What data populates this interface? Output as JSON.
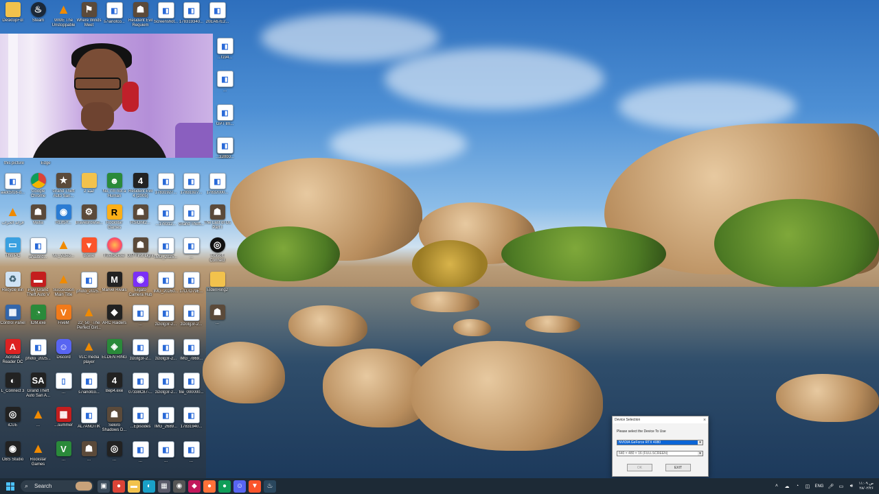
{
  "desktop": {
    "icons": [
      {
        "label": "DesktopFol",
        "glyph": "",
        "kind": "g-folder"
      },
      {
        "label": "Steam",
        "glyph": "♨",
        "kind": "g-steam"
      },
      {
        "label": "WWE The Unstoppable",
        "glyph": "▲",
        "kind": "g-vlc"
      },
      {
        "label": "Where Winds Meet",
        "glyph": "⚑",
        "kind": "g-game"
      },
      {
        "label": "s7ianotco...",
        "glyph": "◧",
        "kind": "g-file"
      },
      {
        "label": "Resident Evil Requiem",
        "glyph": "☗",
        "kind": "g-game"
      },
      {
        "label": "Screenshot...",
        "glyph": "◧",
        "kind": "g-file"
      },
      {
        "label": "178319340...",
        "glyph": "◧",
        "kind": "g-file"
      },
      {
        "label": "20EA67E2...",
        "glyph": "◧",
        "kind": "g-file"
      },
      {
        "label": "this picture",
        "glyph": "",
        "kind": "none"
      },
      {
        "label": "Edge",
        "glyph": "",
        "kind": "none"
      },
      {
        "label": "aadc5f16-d...",
        "glyph": "◧",
        "kind": "g-file"
      },
      {
        "label": "Google Chrome",
        "glyph": "",
        "kind": "g-chrome"
      },
      {
        "label": "Grand Theft Auto San...",
        "glyph": "★",
        "kind": "g-game"
      },
      {
        "label": "لعبة 2",
        "glyph": "",
        "kind": "g-folder"
      },
      {
        "label": "No, I'm not a Human",
        "glyph": "☻",
        "kind": "g-green"
      },
      {
        "label": "Resident Evil 4 (2005)",
        "glyph": "4",
        "kind": "g-dark"
      },
      {
        "label": "17831927...",
        "glyph": "◧",
        "kind": "g-file"
      },
      {
        "label": "17831927...",
        "glyph": "◧",
        "kind": "g-file"
      },
      {
        "label": "17832000...",
        "glyph": "◧",
        "kind": "g-file"
      },
      {
        "label": "قراند الحراب",
        "glyph": "▲",
        "kind": "g-vlc"
      },
      {
        "label": "Mafia",
        "glyph": "☗",
        "kind": "g-game"
      },
      {
        "label": "RLrf5Y...",
        "glyph": "◉",
        "kind": "g-blue"
      },
      {
        "label": "BraveBrowse...",
        "glyph": "⚙",
        "kind": "g-game"
      },
      {
        "label": "Rockstar Games",
        "glyph": "R",
        "kind": "g-rockstar"
      },
      {
        "label": "RSiOnit2...",
        "glyph": "☗",
        "kind": "g-game"
      },
      {
        "label": "...178312...",
        "glyph": "◧",
        "kind": "g-file"
      },
      {
        "label": "Grand Theft...",
        "glyph": "◧",
        "kind": "g-file"
      },
      {
        "label": "The Last of Us Part I",
        "glyph": "☗",
        "kind": "g-game"
      },
      {
        "label": "This PC",
        "glyph": "▭",
        "kind": "g-pc"
      },
      {
        "label": "aNalbrd...",
        "glyph": "◧",
        "kind": "g-file"
      },
      {
        "label": "Mr_Video...",
        "glyph": "▲",
        "kind": "g-vlc"
      },
      {
        "label": "Brave",
        "glyph": "▼",
        "kind": "g-brave"
      },
      {
        "label": "Firefox.exe",
        "glyph": "",
        "kind": "g-firefox"
      },
      {
        "label": "007 First Light",
        "glyph": "☗",
        "kind": "g-game"
      },
      {
        "label": "IMG_2025...",
        "glyph": "◧",
        "kind": "g-file"
      },
      {
        "label": "...",
        "glyph": "◧",
        "kind": "g-file"
      },
      {
        "label": "Ubisoft Connect",
        "glyph": "◎",
        "kind": "g-ubisoft"
      },
      {
        "label": "Recycle Bin",
        "glyph": "♻",
        "kind": "g-recycle"
      },
      {
        "label": "Play Grand Theft Auto V",
        "glyph": "▬",
        "kind": "g-red"
      },
      {
        "label": "Succession Main Title",
        "glyph": "▲",
        "kind": "g-vlc"
      },
      {
        "label": "photo_2025...",
        "glyph": "◧",
        "kind": "g-file"
      },
      {
        "label": "Marvel Rivals",
        "glyph": "M",
        "kind": "g-dark"
      },
      {
        "label": "Elgato Camera Hub",
        "glyph": "◉",
        "kind": "g-elgato"
      },
      {
        "label": "IMG_20260...",
        "glyph": "◧",
        "kind": "g-file"
      },
      {
        "label": "17D7D79E...",
        "glyph": "◧",
        "kind": "g-file"
      },
      {
        "label": "EldenRing2",
        "glyph": "",
        "kind": "g-folder"
      },
      {
        "label": "Control Panel",
        "glyph": "▦",
        "kind": "g-control"
      },
      {
        "label": "IDM.exe",
        "glyph": "◔",
        "kind": "g-green"
      },
      {
        "label": "FiveM",
        "glyph": "V",
        "kind": "g-orange"
      },
      {
        "label": "22_50_ The Perfect Girl...",
        "glyph": "▲",
        "kind": "g-vlc"
      },
      {
        "label": "ARC Raiders",
        "glyph": "◆",
        "kind": "g-dark"
      },
      {
        "label": "...",
        "glyph": "◧",
        "kind": "g-file"
      },
      {
        "label": "zizotg3r-2...",
        "glyph": "◧",
        "kind": "g-file"
      },
      {
        "label": "zizotg3r-2...",
        "glyph": "◧",
        "kind": "g-file"
      },
      {
        "label": "...",
        "glyph": "☗",
        "kind": "g-game"
      },
      {
        "label": "Acrobat Reader DC",
        "glyph": "A",
        "kind": "g-pdf"
      },
      {
        "label": "photo_2025...",
        "glyph": "◧",
        "kind": "g-file"
      },
      {
        "label": "Discord",
        "glyph": "☺",
        "kind": "g-discord"
      },
      {
        "label": "VLC media player",
        "glyph": "▲",
        "kind": "g-vlc"
      },
      {
        "label": "ELDEN RING",
        "glyph": "◈",
        "kind": "g-green"
      },
      {
        "label": "zizotg3r-2...",
        "glyph": "◧",
        "kind": "g-file"
      },
      {
        "label": "zizotg3r-2...",
        "glyph": "◧",
        "kind": "g-file"
      },
      {
        "label": "IMG_7869...",
        "glyph": "◧",
        "kind": "g-file"
      },
      {
        "label": "L_Connect 3",
        "glyph": "◐",
        "kind": "g-dark"
      },
      {
        "label": "Grand Theft Auto San A...",
        "glyph": "SA",
        "kind": "g-dark"
      },
      {
        "label": "...",
        "glyph": "▯",
        "kind": "g-file"
      },
      {
        "label": "s7ianotco...",
        "glyph": "◧",
        "kind": "g-file"
      },
      {
        "label": "Bep4.exe",
        "glyph": "4",
        "kind": "g-dark"
      },
      {
        "label": "07338C87-...",
        "glyph": "◧",
        "kind": "g-file"
      },
      {
        "label": "zizotg3r-2...",
        "glyph": "◧",
        "kind": "g-file"
      },
      {
        "label": "file_000000...",
        "glyph": "◧",
        "kind": "g-file"
      },
      {
        "label": "iCUE",
        "glyph": "◎",
        "kind": "g-dark"
      },
      {
        "label": "...",
        "glyph": "▲",
        "kind": "g-vlc"
      },
      {
        "label": "...summer",
        "glyph": "▦",
        "kind": "g-red"
      },
      {
        "label": "AL7ANOTIK",
        "glyph": "◧",
        "kind": "g-file"
      },
      {
        "label": "Sekiro Shadows D...",
        "glyph": "☗",
        "kind": "g-game"
      },
      {
        "label": "...Episodes",
        "glyph": "◧",
        "kind": "g-file"
      },
      {
        "label": "IMG_2689...",
        "glyph": "◧",
        "kind": "g-file"
      },
      {
        "label": "17831940...",
        "glyph": "◧",
        "kind": "g-file"
      },
      {
        "label": "OBS Studio",
        "glyph": "◉",
        "kind": "g-dark"
      },
      {
        "label": "Rockstar Games",
        "glyph": "▲",
        "kind": "g-vlc"
      },
      {
        "label": "...",
        "glyph": "V",
        "kind": "g-green"
      },
      {
        "label": "...",
        "glyph": "☗",
        "kind": "g-game"
      },
      {
        "label": "...",
        "glyph": "◎",
        "kind": "g-dark"
      },
      {
        "label": "...",
        "glyph": "◧",
        "kind": "g-file"
      },
      {
        "label": "...",
        "glyph": "◧",
        "kind": "g-file"
      },
      {
        "label": "...",
        "glyph": "◧",
        "kind": "g-file"
      },
      {
        "label": "...f194...",
        "glyph": "◧",
        "kind": "g-file"
      },
      {
        "label": "...",
        "glyph": "◧",
        "kind": "g-file"
      },
      {
        "label": "GPT Im...",
        "glyph": "◧",
        "kind": "g-file"
      },
      {
        "label": "...3cd...",
        "glyph": "◧",
        "kind": "g-file"
      },
      {
        "label": "...32000...",
        "glyph": "◧",
        "kind": "g-file"
      }
    ]
  },
  "dialog": {
    "title": "Device Selection",
    "prompt": "Please select the Device To Use",
    "device_value": "NVIDIA GeForce RTX 4080",
    "mode_value": "640 × 480 × 16 (FULLSCREEN)",
    "ok_label": "OK",
    "exit_label": "EXIT",
    "close_glyph": "×"
  },
  "taskbar": {
    "search_placeholder": "Search",
    "language": "ENG",
    "time": "۱۱:۰۹ ص",
    "date": "۲۸/۰۲/۲۶",
    "apps": [
      {
        "name": "task-view",
        "glyph": "▣",
        "color": "#3a4a5a"
      },
      {
        "name": "chrome",
        "glyph": "●",
        "color": "#db4437"
      },
      {
        "name": "file-explorer",
        "glyph": "▬",
        "color": "#f2c24c"
      },
      {
        "name": "edge",
        "glyph": "◐",
        "color": "#1aa0c8"
      },
      {
        "name": "media",
        "glyph": "▦",
        "color": "#5a5a6a"
      },
      {
        "name": "camera",
        "glyph": "◉",
        "color": "#555"
      },
      {
        "name": "app-pink",
        "glyph": "◆",
        "color": "#c2185b"
      },
      {
        "name": "firefox",
        "glyph": "●",
        "color": "#ff7139"
      },
      {
        "name": "chrome-2",
        "glyph": "●",
        "color": "#0f9d58"
      },
      {
        "name": "discord",
        "glyph": "☺",
        "color": "#5865f2"
      },
      {
        "name": "brave",
        "glyph": "▼",
        "color": "#fb542b"
      },
      {
        "name": "steam",
        "glyph": "♨",
        "color": "#2a475e"
      }
    ]
  }
}
